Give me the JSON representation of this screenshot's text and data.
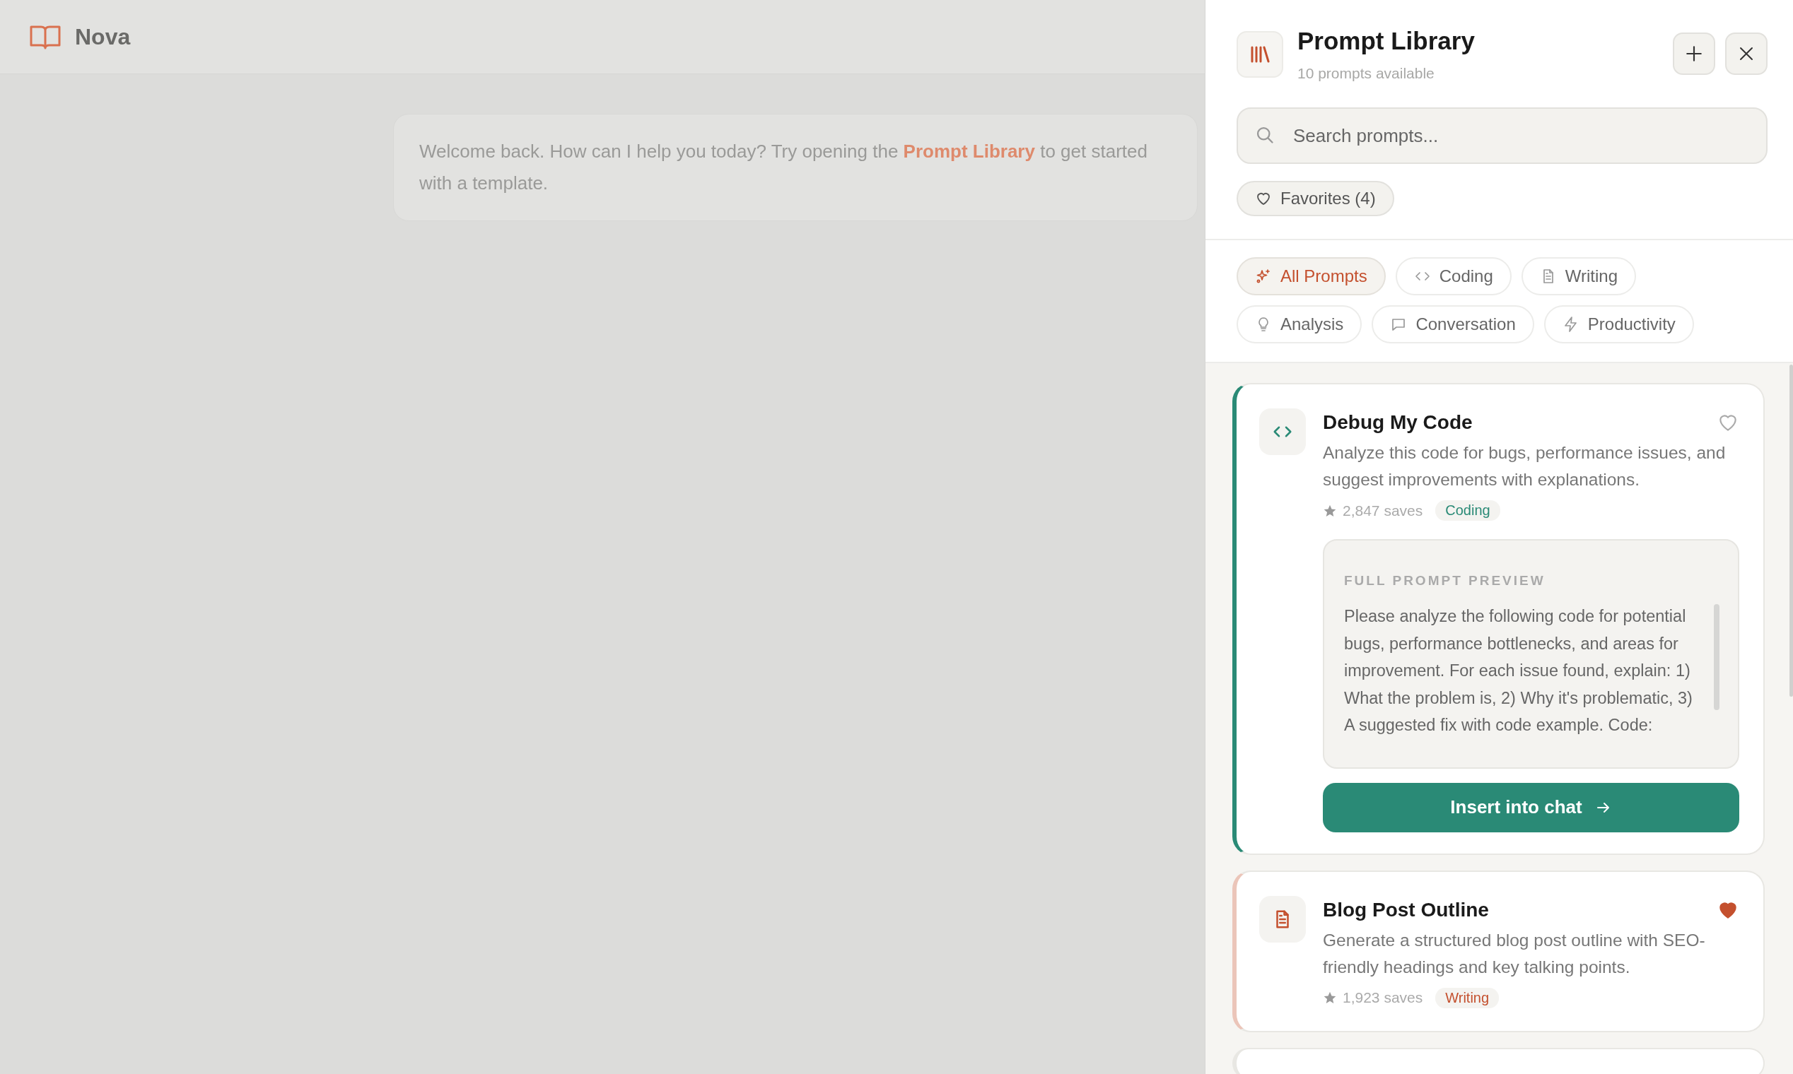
{
  "app": {
    "name": "Nova"
  },
  "chat": {
    "text_before": "Welcome back. How can I help you today? Try opening the ",
    "link": "Prompt Library",
    "text_after": " to get started with a template."
  },
  "panel": {
    "title": "Prompt Library",
    "subtitle": "10 prompts available",
    "search": {
      "placeholder": "Search prompts..."
    },
    "favorites": {
      "label": "Favorites (4)"
    },
    "categories": [
      {
        "label": "All Prompts",
        "kind": "all",
        "selected": true
      },
      {
        "label": "Coding",
        "kind": "coding",
        "selected": false
      },
      {
        "label": "Writing",
        "kind": "writing",
        "selected": false
      },
      {
        "label": "Analysis",
        "kind": "analysis",
        "selected": false
      },
      {
        "label": "Conversation",
        "kind": "conversation",
        "selected": false
      },
      {
        "label": "Productivity",
        "kind": "productivity",
        "selected": false
      }
    ],
    "prompts": [
      {
        "kind": "coding",
        "title": "Debug My Code",
        "description": "Analyze this code for bugs, performance issues, and suggest improvements with explanations.",
        "saves": "2,847 saves",
        "tag": "Coding",
        "color": "#2a8a76",
        "favorite": false,
        "expanded": true,
        "preview_label": "FULL PROMPT PREVIEW",
        "preview": "Please analyze the following code for potential bugs, performance bottlenecks, and areas for improvement. For each issue found, explain: 1) What the problem is, 2) Why it's problematic, 3) A suggested fix with code example. Code:",
        "action": "Insert into chat"
      },
      {
        "kind": "writing",
        "title": "Blog Post Outline",
        "description": "Generate a structured blog post outline with SEO-friendly headings and key talking points.",
        "saves": "1,923 saves",
        "tag": "Writing",
        "color": "#c4502e",
        "favorite": true,
        "expanded": false
      }
    ]
  }
}
